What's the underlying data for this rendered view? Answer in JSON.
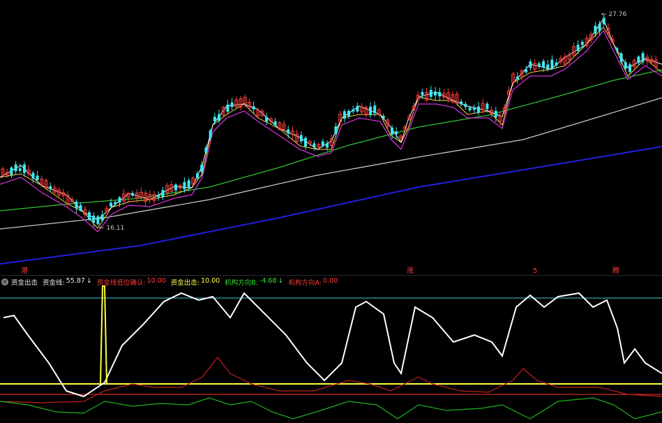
{
  "chart": {
    "price_high": {
      "value": "27.76",
      "arrow": "←"
    },
    "price_low": {
      "value": "16.11",
      "arrow": "←"
    }
  },
  "markers": [
    {
      "text": "港",
      "color": "#ff3b3b"
    },
    {
      "text": "涨",
      "color": "#ff3b3b"
    },
    {
      "text": "5",
      "color": "#ff3b3b"
    },
    {
      "text": "腾",
      "color": "#ff3b3b"
    }
  ],
  "indicator": {
    "name": "资金出击",
    "items": [
      {
        "label": "资金线:",
        "value": "55.87",
        "arrow": "↓",
        "color": "#e6e6e6"
      },
      {
        "label": "资金线低位确认:",
        "value": "10.00",
        "arrow": "",
        "color": "#ff3b3b"
      },
      {
        "label": "资金出击:",
        "value": "10.00",
        "arrow": "",
        "color": "#ffff4d"
      },
      {
        "label": "机构方向B:",
        "value": "-4.68",
        "arrow": "↓",
        "color": "#2ee62e"
      },
      {
        "label": "机构方向A:",
        "value": "0.00",
        "arrow": "",
        "color": "#ff3b3b"
      }
    ]
  },
  "colors": {
    "up_candle": "#ff3b3b",
    "down_candle": "#3ee8f0",
    "ma_short": "#ffffff",
    "ma_yellow": "#ffd24a",
    "ma_purple": "#d030d0",
    "ma_green": "#30c030",
    "ma_gray": "#c8c8c8",
    "ma_blue": "#2020e0",
    "fund_line": "#ffffff",
    "threshold_cyan": "#40c8e0",
    "threshold_yellow": "#ffff40",
    "threshold_red": "#ff3030"
  }
}
